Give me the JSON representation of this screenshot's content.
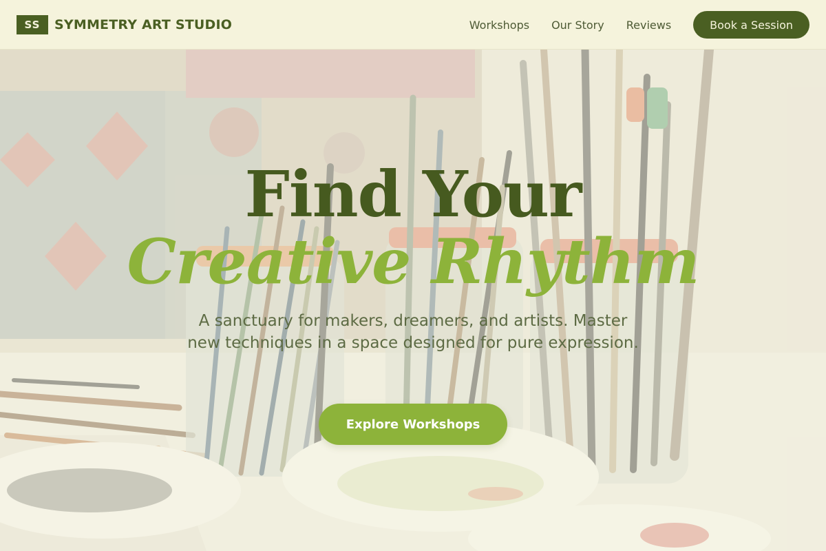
{
  "brand": {
    "mark": "SS",
    "name": "SYMMETRY ART STUDIO"
  },
  "nav": {
    "links": [
      "Workshops",
      "Our Story",
      "Reviews"
    ],
    "cta": "Book a Session"
  },
  "hero": {
    "title_line1": "Find Your",
    "title_line2": "Creative Rhythm",
    "subtitle": "A sanctuary for makers, dreamers, and artists. Master new techniques in a space designed for pure expression.",
    "cta": "Explore Workshops",
    "background_icon": "paintbrush-jars-photo"
  },
  "colors": {
    "primary_dark_green": "#4a5f22",
    "accent_light_green": "#8db33a",
    "nav_background": "#f5f3dc",
    "text_muted": "#5d6b44"
  }
}
